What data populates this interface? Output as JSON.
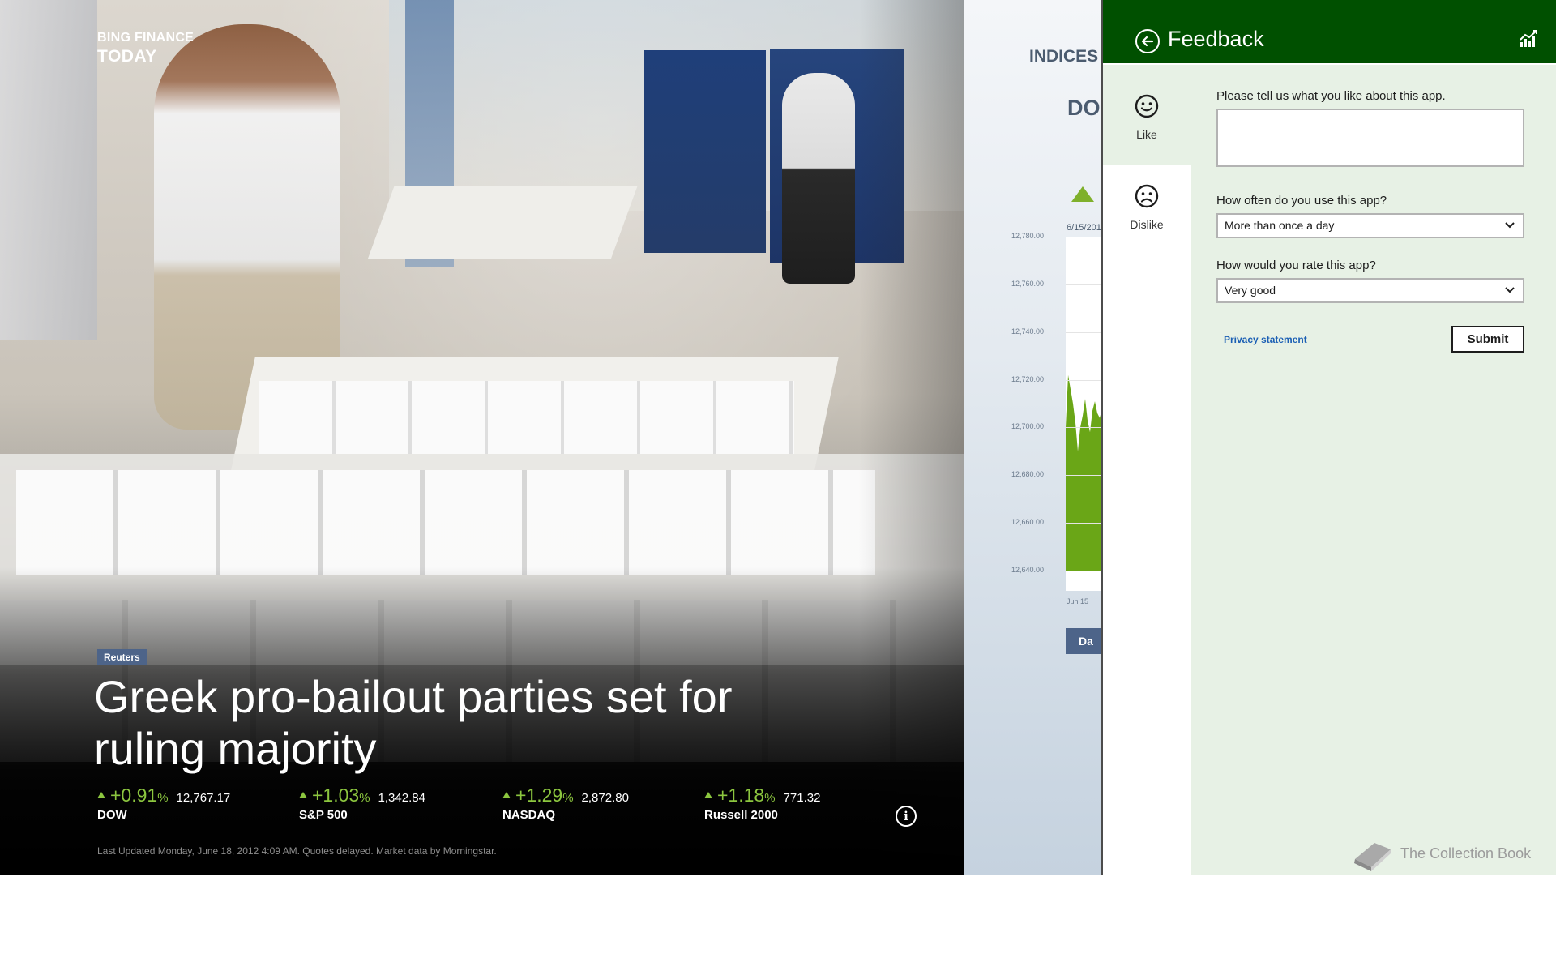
{
  "app": {
    "brand_line1": "BING FINANCE",
    "brand_line2": "TODAY"
  },
  "hero": {
    "source": "Reuters",
    "headline_line1": "Greek pro-bailout parties set for",
    "headline_line2": "ruling majority",
    "tickers": [
      {
        "name": "DOW",
        "change_pct": "+0.91",
        "pct_sign": "%",
        "value": "12,767.17",
        "direction": "up"
      },
      {
        "name": "S&P 500",
        "change_pct": "+1.03",
        "pct_sign": "%",
        "value": "1,342.84",
        "direction": "up"
      },
      {
        "name": "NASDAQ",
        "change_pct": "+1.29",
        "pct_sign": "%",
        "value": "2,872.80",
        "direction": "up"
      },
      {
        "name": "Russell 2000",
        "change_pct": "+1.18",
        "pct_sign": "%",
        "value": "771.32",
        "direction": "up"
      }
    ],
    "last_updated": "Last Updated Monday, June 18, 2012 4:09 AM. Quotes delayed. Market data by Morningstar.",
    "up_color": "#8cc63f"
  },
  "indices": {
    "header": "INDICES",
    "index_name_partial": "DO",
    "date_label": "6/15/201",
    "x_label": "Jun 15",
    "range_button_partial": "Da",
    "accent_color": "#7fb02b"
  },
  "chart_data": {
    "type": "area",
    "title": "",
    "xlabel": "",
    "ylabel": "",
    "ylim": [
      12640,
      12780
    ],
    "y_ticks": [
      "12,780.00",
      "12,760.00",
      "12,740.00",
      "12,720.00",
      "12,700.00",
      "12,680.00",
      "12,660.00",
      "12,640.00"
    ],
    "x_ticks": [
      "Jun 15"
    ],
    "x": [
      0,
      1,
      2,
      3,
      4,
      5,
      6,
      7,
      8,
      9,
      10,
      11,
      12,
      13,
      14,
      15,
      16
    ],
    "values": [
      12700,
      12722,
      12716,
      12710,
      12702,
      12690,
      12700,
      12705,
      12712,
      12703,
      12698,
      12707,
      12711,
      12706,
      12704,
      12708,
      12705
    ],
    "series_color": "#6aa617"
  },
  "feedback": {
    "title": "Feedback",
    "tabs": [
      {
        "label": "Like",
        "icon": "smile-icon"
      },
      {
        "label": "Dislike",
        "icon": "frown-icon"
      }
    ],
    "q1": "Please tell us what you like about this app.",
    "q1_value": "",
    "q2": "How often do you use this app?",
    "q2_value": "More than once a day",
    "q3": "How would you rate this app?",
    "q3_value": "Very good",
    "privacy_link": "Privacy statement",
    "submit_label": "Submit",
    "header_color": "#005000",
    "panel_color": "#e7f1e5"
  },
  "watermark": {
    "text": "The Collection Book"
  }
}
